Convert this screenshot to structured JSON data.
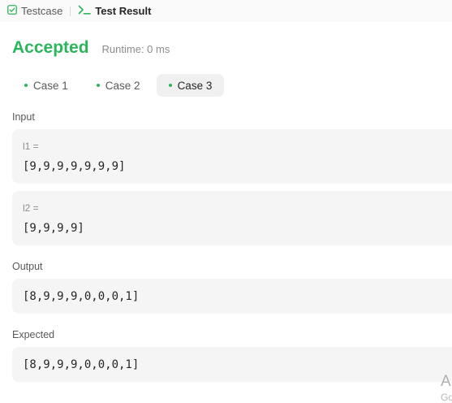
{
  "header": {
    "tabs": [
      {
        "label": "Testcase",
        "icon": "checkbox-icon"
      },
      {
        "label": "Test Result",
        "icon": "terminal-icon"
      }
    ]
  },
  "result": {
    "status": "Accepted",
    "runtime": "Runtime: 0 ms",
    "status_color": "#2db55d"
  },
  "cases": [
    {
      "label": "Case 1"
    },
    {
      "label": "Case 2"
    },
    {
      "label": "Case 3"
    }
  ],
  "active_case": "Case 3",
  "input": {
    "label": "Input",
    "params": [
      {
        "name": "l1 =",
        "value": "[9,9,9,9,9,9,9]"
      },
      {
        "name": "l2 =",
        "value": "[9,9,9,9]"
      }
    ]
  },
  "output": {
    "label": "Output",
    "value": "[8,9,9,9,0,0,0,1]"
  },
  "expected": {
    "label": "Expected",
    "value": "[8,9,9,9,0,0,0,1]"
  },
  "watermark": {
    "line1": "A",
    "line2": "Go"
  }
}
